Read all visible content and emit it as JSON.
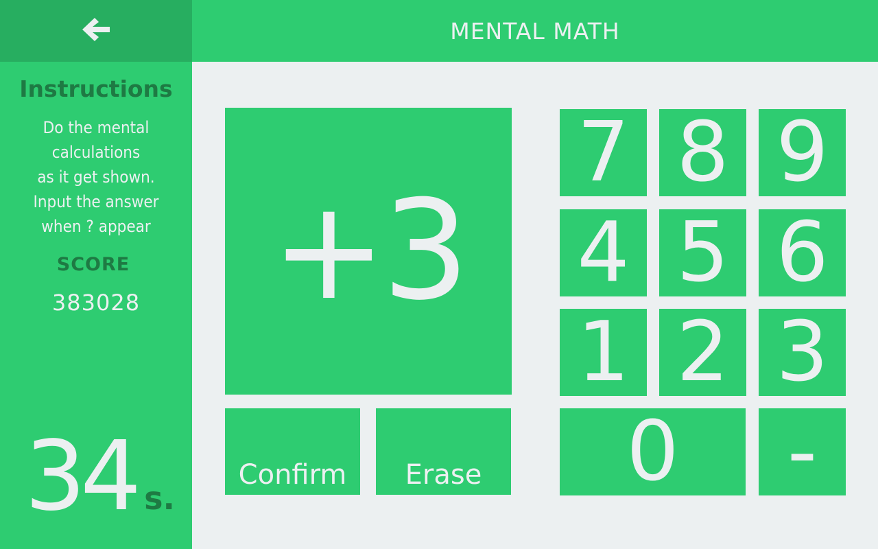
{
  "header": {
    "back_icon": "arrow-left-icon",
    "title": "MENTAL MATH"
  },
  "sidebar": {
    "instructions_title": "Instructions",
    "instructions_lines": [
      "Do the mental",
      "calculations",
      "as it get shown.",
      "Input the answer",
      "when ? appear"
    ],
    "score_label": "SCORE",
    "score_value": "383028",
    "timer_value": "34",
    "timer_unit": "s."
  },
  "game": {
    "question": "+3",
    "confirm_label": "Confirm",
    "erase_label": "Erase"
  },
  "keypad": {
    "keys": [
      "7",
      "8",
      "9",
      "4",
      "5",
      "6",
      "1",
      "2",
      "3",
      "0",
      "-"
    ]
  },
  "colors": {
    "primary": "#2ECC71",
    "primary_dark": "#27AE60",
    "text_dark": "#1E7A43",
    "background": "#ECF0F1"
  }
}
